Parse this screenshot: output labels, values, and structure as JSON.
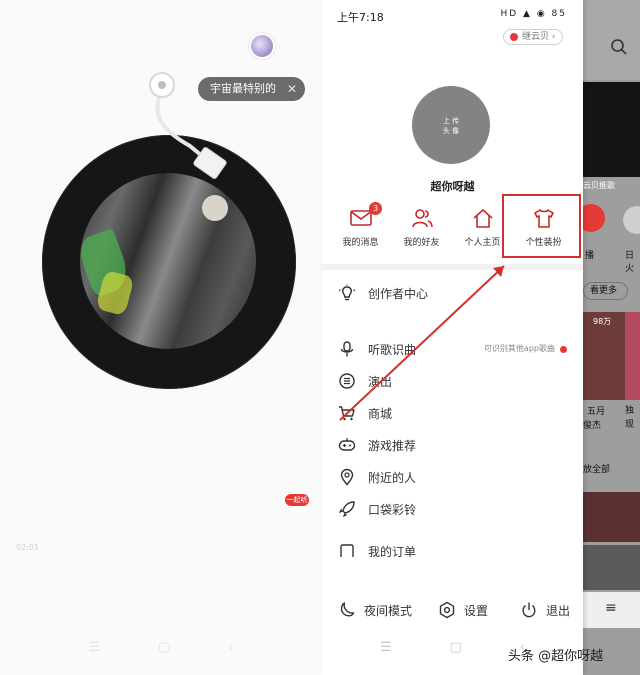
{
  "left": {
    "tip_text": "宇宙最特别的",
    "tip_close": "✕",
    "share_label": "一起听",
    "time_elapsed": "02:01"
  },
  "status_bar": {
    "time": "上午7:18",
    "icons": "HD ▲ ◉ 85"
  },
  "drawer": {
    "vip_label": "继云贝",
    "upload_line1": "上 传",
    "upload_line2": "头 像",
    "username": "超你呀越",
    "shortcuts": [
      {
        "label": "我的消息",
        "badge": "3",
        "icon": "mail-icon"
      },
      {
        "label": "我的好友",
        "icon": "friends-icon"
      },
      {
        "label": "个人主页",
        "icon": "home-icon"
      },
      {
        "label": "个性装扮",
        "icon": "tshirt-icon"
      }
    ],
    "menu": [
      {
        "label": "创作者中心",
        "icon": "bulb-icon"
      },
      {
        "label": "听歌识曲",
        "icon": "mic-icon",
        "sub": "可识别其他app歌曲"
      },
      {
        "label": "演出",
        "icon": "ticket-icon"
      },
      {
        "label": "商城",
        "icon": "cart-icon"
      },
      {
        "label": "游戏推荐",
        "icon": "gamepad-icon"
      },
      {
        "label": "附近的人",
        "icon": "location-icon"
      },
      {
        "label": "口袋彩铃",
        "icon": "rocket-icon"
      },
      {
        "label": "我的订单",
        "icon": "order-icon"
      }
    ],
    "bottom": {
      "night_mode": "夜间模式",
      "settings": "设置",
      "logout": "退出"
    }
  },
  "peek": {
    "tag_recommend": "云贝推歌",
    "tag_broadcast": "播",
    "tag_day": "日火",
    "see_more": "看更多",
    "play_count": "98万",
    "text_a": "五月",
    "text_b": "俊杰",
    "text_c": "独 现",
    "play_all": "放全部"
  },
  "watermark": "头条 @超你呀越",
  "colors": {
    "accent": "#e53935",
    "highlight_box": "#d32f2f"
  }
}
